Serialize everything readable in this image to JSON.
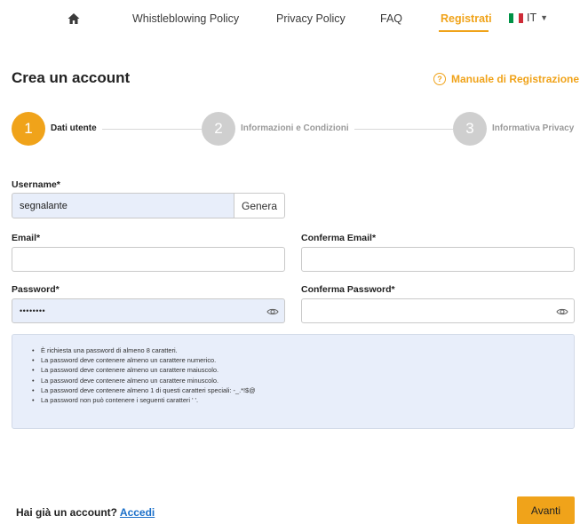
{
  "nav": {
    "home_icon": "home-icon",
    "items": [
      {
        "label": "Whistleblowing Policy"
      },
      {
        "label": "Privacy Policy"
      },
      {
        "label": "FAQ"
      },
      {
        "label": "Registrati"
      }
    ],
    "active_item": "Registrati",
    "language": {
      "code": "IT",
      "flag_colors": [
        "#009246",
        "#ffffff",
        "#ce2b37"
      ]
    }
  },
  "page": {
    "title": "Crea un account",
    "manual_label": "Manuale di Registrazione",
    "manual_icon": "question-circle-icon"
  },
  "steps": [
    {
      "number": "1",
      "label": "Dati utente",
      "active": true
    },
    {
      "number": "2",
      "label": "Informazioni e Condizioni",
      "active": false
    },
    {
      "number": "3",
      "label": "Informativa Privacy",
      "active": false
    }
  ],
  "form": {
    "username": {
      "label": "Username*",
      "value": "segnalante",
      "generate_label": "Genera"
    },
    "email": {
      "label": "Email*",
      "value": ""
    },
    "confirm_email": {
      "label": "Conferma Email*",
      "value": ""
    },
    "password": {
      "label": "Password*",
      "value": "••••••••"
    },
    "confirm_password": {
      "label": "Conferma Password*",
      "value": ""
    }
  },
  "password_rules": [
    "È richiesta una password di almeno 8 caratteri.",
    "La password deve contenere almeno un carattere numerico.",
    "La password deve contenere almeno un carattere maiuscolo.",
    "La password deve contenere almeno un carattere minuscolo.",
    "La password deve contenere almeno 1 di questi caratteri speciali: -_.*!$@",
    "La password non può contenere i seguenti caratteri ' '."
  ],
  "footer": {
    "question": "Hai già un account?",
    "login_link": "Accedi",
    "next_button": "Avanti"
  },
  "colors": {
    "accent": "#f0a31a",
    "link": "#1a6fc9",
    "input_fill": "#e8eefa",
    "step_inactive": "#cfcfcf"
  }
}
